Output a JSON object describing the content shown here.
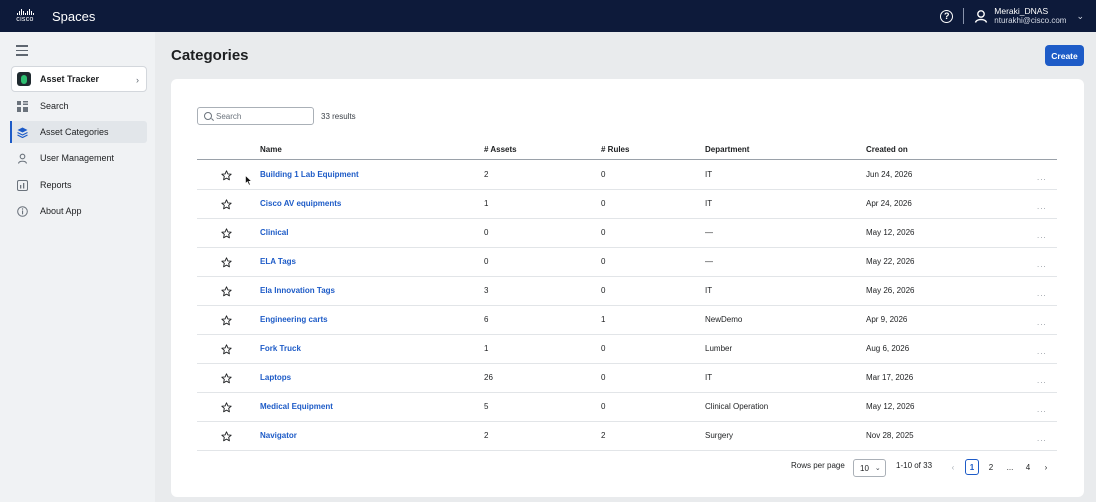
{
  "topbar": {
    "logo_text": "cisco",
    "title": "Spaces",
    "user_name": "Meraki_DNAS",
    "user_email": "nturakhi@cisco.com"
  },
  "sidebar": {
    "app_name": "Asset Tracker",
    "items": [
      {
        "label": "Search",
        "icon": "grid-icon"
      },
      {
        "label": "Asset Categories",
        "icon": "layers-icon",
        "active": true
      },
      {
        "label": "User Management",
        "icon": "user-icon"
      },
      {
        "label": "Reports",
        "icon": "chart-icon"
      },
      {
        "label": "About App",
        "icon": "info-icon"
      }
    ]
  },
  "main": {
    "title": "Categories",
    "create_label": "Create",
    "search_placeholder": "Search",
    "results_text": "33 results",
    "columns": [
      "Name",
      "# Assets",
      "# Rules",
      "Department",
      "Created on"
    ],
    "rows": [
      {
        "name": "Building 1 Lab Equipment",
        "assets": "2",
        "rules": "0",
        "department": "IT",
        "created": "Jun 24, 2026"
      },
      {
        "name": "Cisco AV equipments",
        "assets": "1",
        "rules": "0",
        "department": "IT",
        "created": "Apr 24, 2026"
      },
      {
        "name": "Clinical",
        "assets": "0",
        "rules": "0",
        "department": "—",
        "created": "May 12, 2026"
      },
      {
        "name": "ELA Tags",
        "assets": "0",
        "rules": "0",
        "department": "—",
        "created": "May 22, 2026"
      },
      {
        "name": "Ela Innovation Tags",
        "assets": "3",
        "rules": "0",
        "department": "IT",
        "created": "May 26, 2026"
      },
      {
        "name": "Engineering carts",
        "assets": "6",
        "rules": "1",
        "department": "NewDemo",
        "created": "Apr 9, 2026"
      },
      {
        "name": "Fork Truck",
        "assets": "1",
        "rules": "0",
        "department": "Lumber",
        "created": "Aug 6, 2026"
      },
      {
        "name": "Laptops",
        "assets": "26",
        "rules": "0",
        "department": "IT",
        "created": "Mar 17, 2026"
      },
      {
        "name": "Medical Equipment",
        "assets": "5",
        "rules": "0",
        "department": "Clinical Operation",
        "created": "May 12, 2026"
      },
      {
        "name": "Navigator",
        "assets": "2",
        "rules": "2",
        "department": "Surgery",
        "created": "Nov 28, 2025"
      }
    ],
    "row_menu": "...",
    "pagination": {
      "rows_per_page_label": "Rows per page",
      "rows_per_page": "10",
      "range": "1-10 of 33",
      "pages": [
        "1",
        "2",
        "...",
        "4"
      ],
      "current": "1"
    }
  },
  "colors": {
    "topbar": "#0d1a3a",
    "accent": "#1d5bc7"
  }
}
